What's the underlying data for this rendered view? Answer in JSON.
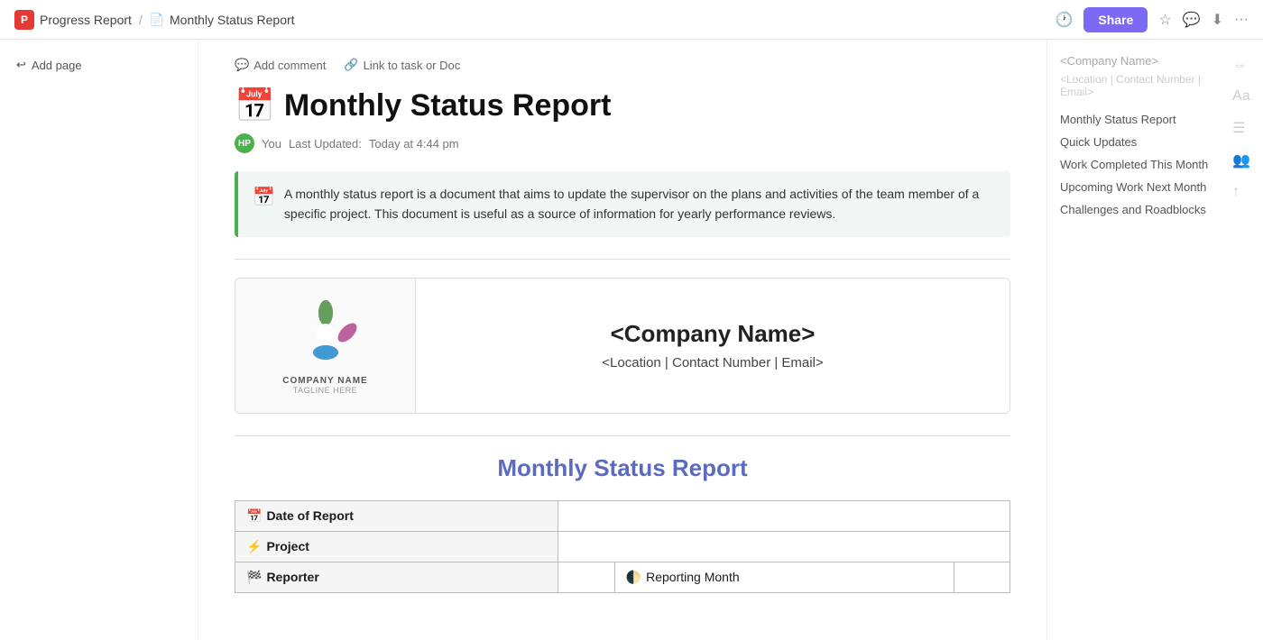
{
  "app": {
    "logo_text": "P",
    "breadcrumb_root": "Progress Report",
    "breadcrumb_sep": "/",
    "doc_icon": "📄",
    "doc_title_breadcrumb": "Monthly Status Report"
  },
  "nav": {
    "share_label": "Share",
    "history_icon": "🕐",
    "star_icon": "☆",
    "chat_icon": "💬",
    "download_icon": "⬇",
    "more_icon": "···"
  },
  "sidebar_left": {
    "add_page_label": "Add page"
  },
  "toolbar": {
    "comment_label": "Add comment",
    "link_label": "Link to task or Doc"
  },
  "document": {
    "title_icon": "📅",
    "title": "Monthly Status Report",
    "author_initials": "HP",
    "author": "You",
    "last_updated_label": "Last Updated:",
    "last_updated": "Today at 4:44 pm",
    "callout_text": "A monthly status report is a document that aims to update the supervisor on the plans and activities of the team member of a specific project. This document is useful as a source of information for yearly performance reviews."
  },
  "company": {
    "logo_label": "COMPANY NAME",
    "tagline": "TAGLINE HERE",
    "name_placeholder": "<Company Name>",
    "contact_placeholder": "<Location | Contact Number | Email>"
  },
  "section_title": "Monthly Status Report",
  "table": {
    "rows": [
      {
        "label": "📅 Date of Report",
        "value": "",
        "extra_label": "",
        "extra_value": ""
      },
      {
        "label": "⚡ Project",
        "value": "",
        "extra_label": "",
        "extra_value": ""
      },
      {
        "label": "🏁 Reporter",
        "value": "",
        "extra_label": "🌓 Reporting Month",
        "extra_value": ""
      }
    ]
  },
  "toc": {
    "company_name_placeholder": "<Company Name>",
    "contact_placeholder": "<Location | Contact Number | Email>",
    "items": [
      "Monthly Status Report",
      "Quick Updates",
      "Work Completed This Month",
      "Upcoming Work Next Month",
      "Challenges and Roadblocks"
    ]
  }
}
